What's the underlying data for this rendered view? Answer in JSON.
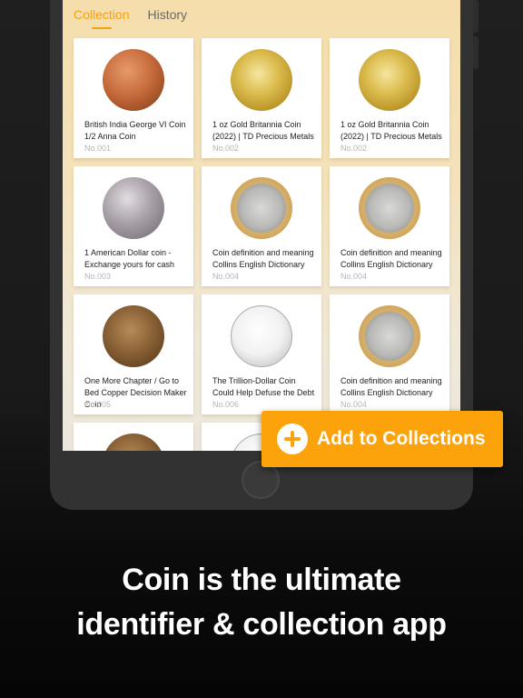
{
  "tabs": [
    {
      "label": "Collection",
      "active": true
    },
    {
      "label": "History",
      "active": false
    }
  ],
  "coins": [
    {
      "title": "British India George VI Coin 1/2 Anna Coin",
      "number": "No.001",
      "image": "copper-coin"
    },
    {
      "title": "1 oz Gold Britannia Coin (2022) | TD Precious Metals",
      "number": "No.002",
      "image": "gold-coin"
    },
    {
      "title": "1 oz Gold Britannia Coin (2022) | TD Precious Metals",
      "number": "No.002",
      "image": "gold-coin"
    },
    {
      "title": "1 American Dollar coin - Exchange yours for cash",
      "number": "No.003",
      "image": "silver-coin"
    },
    {
      "title": "Coin definition and meaning Collins English Dictionary",
      "number": "No.004",
      "image": "bimetal-coin"
    },
    {
      "title": "Coin definition and meaning Collins English Dictionary",
      "number": "No.004",
      "image": "bimetal-coin"
    },
    {
      "title": "One More Chapter / Go to Bed Copper Decision Maker Coin",
      "number": "No.005",
      "image": "bronze-coin"
    },
    {
      "title": "The Trillion-Dollar Coin Could Help Defuse the Debt",
      "number": "No.006",
      "image": "platinum-coin"
    },
    {
      "title": "Coin definition and meaning Collins English Dictionary",
      "number": "No.004",
      "image": "bimetal-coin"
    },
    {
      "title": "",
      "number": "",
      "image": "bronze-coin"
    },
    {
      "title": "",
      "number": "",
      "image": "platinum-coin"
    }
  ],
  "cta": {
    "label": "Add to Collections",
    "icon": "plus-circle-icon"
  },
  "headline": {
    "line1": "Coin is the ultimate",
    "line2": "identifier & collection app"
  },
  "colors": {
    "accent": "#fca20a",
    "tab_active": "#f4a20f"
  }
}
